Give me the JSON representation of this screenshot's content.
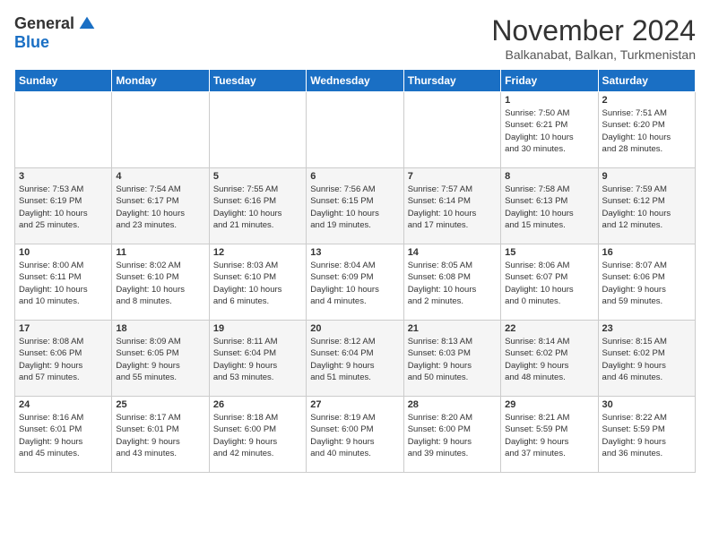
{
  "header": {
    "logo_general": "General",
    "logo_blue": "Blue",
    "month_title": "November 2024",
    "subtitle": "Balkanabat, Balkan, Turkmenistan"
  },
  "weekdays": [
    "Sunday",
    "Monday",
    "Tuesday",
    "Wednesday",
    "Thursday",
    "Friday",
    "Saturday"
  ],
  "weeks": [
    [
      {
        "day": "",
        "info": ""
      },
      {
        "day": "",
        "info": ""
      },
      {
        "day": "",
        "info": ""
      },
      {
        "day": "",
        "info": ""
      },
      {
        "day": "",
        "info": ""
      },
      {
        "day": "1",
        "info": "Sunrise: 7:50 AM\nSunset: 6:21 PM\nDaylight: 10 hours\nand 30 minutes."
      },
      {
        "day": "2",
        "info": "Sunrise: 7:51 AM\nSunset: 6:20 PM\nDaylight: 10 hours\nand 28 minutes."
      }
    ],
    [
      {
        "day": "3",
        "info": "Sunrise: 7:53 AM\nSunset: 6:19 PM\nDaylight: 10 hours\nand 25 minutes."
      },
      {
        "day": "4",
        "info": "Sunrise: 7:54 AM\nSunset: 6:17 PM\nDaylight: 10 hours\nand 23 minutes."
      },
      {
        "day": "5",
        "info": "Sunrise: 7:55 AM\nSunset: 6:16 PM\nDaylight: 10 hours\nand 21 minutes."
      },
      {
        "day": "6",
        "info": "Sunrise: 7:56 AM\nSunset: 6:15 PM\nDaylight: 10 hours\nand 19 minutes."
      },
      {
        "day": "7",
        "info": "Sunrise: 7:57 AM\nSunset: 6:14 PM\nDaylight: 10 hours\nand 17 minutes."
      },
      {
        "day": "8",
        "info": "Sunrise: 7:58 AM\nSunset: 6:13 PM\nDaylight: 10 hours\nand 15 minutes."
      },
      {
        "day": "9",
        "info": "Sunrise: 7:59 AM\nSunset: 6:12 PM\nDaylight: 10 hours\nand 12 minutes."
      }
    ],
    [
      {
        "day": "10",
        "info": "Sunrise: 8:00 AM\nSunset: 6:11 PM\nDaylight: 10 hours\nand 10 minutes."
      },
      {
        "day": "11",
        "info": "Sunrise: 8:02 AM\nSunset: 6:10 PM\nDaylight: 10 hours\nand 8 minutes."
      },
      {
        "day": "12",
        "info": "Sunrise: 8:03 AM\nSunset: 6:10 PM\nDaylight: 10 hours\nand 6 minutes."
      },
      {
        "day": "13",
        "info": "Sunrise: 8:04 AM\nSunset: 6:09 PM\nDaylight: 10 hours\nand 4 minutes."
      },
      {
        "day": "14",
        "info": "Sunrise: 8:05 AM\nSunset: 6:08 PM\nDaylight: 10 hours\nand 2 minutes."
      },
      {
        "day": "15",
        "info": "Sunrise: 8:06 AM\nSunset: 6:07 PM\nDaylight: 10 hours\nand 0 minutes."
      },
      {
        "day": "16",
        "info": "Sunrise: 8:07 AM\nSunset: 6:06 PM\nDaylight: 9 hours\nand 59 minutes."
      }
    ],
    [
      {
        "day": "17",
        "info": "Sunrise: 8:08 AM\nSunset: 6:06 PM\nDaylight: 9 hours\nand 57 minutes."
      },
      {
        "day": "18",
        "info": "Sunrise: 8:09 AM\nSunset: 6:05 PM\nDaylight: 9 hours\nand 55 minutes."
      },
      {
        "day": "19",
        "info": "Sunrise: 8:11 AM\nSunset: 6:04 PM\nDaylight: 9 hours\nand 53 minutes."
      },
      {
        "day": "20",
        "info": "Sunrise: 8:12 AM\nSunset: 6:04 PM\nDaylight: 9 hours\nand 51 minutes."
      },
      {
        "day": "21",
        "info": "Sunrise: 8:13 AM\nSunset: 6:03 PM\nDaylight: 9 hours\nand 50 minutes."
      },
      {
        "day": "22",
        "info": "Sunrise: 8:14 AM\nSunset: 6:02 PM\nDaylight: 9 hours\nand 48 minutes."
      },
      {
        "day": "23",
        "info": "Sunrise: 8:15 AM\nSunset: 6:02 PM\nDaylight: 9 hours\nand 46 minutes."
      }
    ],
    [
      {
        "day": "24",
        "info": "Sunrise: 8:16 AM\nSunset: 6:01 PM\nDaylight: 9 hours\nand 45 minutes."
      },
      {
        "day": "25",
        "info": "Sunrise: 8:17 AM\nSunset: 6:01 PM\nDaylight: 9 hours\nand 43 minutes."
      },
      {
        "day": "26",
        "info": "Sunrise: 8:18 AM\nSunset: 6:00 PM\nDaylight: 9 hours\nand 42 minutes."
      },
      {
        "day": "27",
        "info": "Sunrise: 8:19 AM\nSunset: 6:00 PM\nDaylight: 9 hours\nand 40 minutes."
      },
      {
        "day": "28",
        "info": "Sunrise: 8:20 AM\nSunset: 6:00 PM\nDaylight: 9 hours\nand 39 minutes."
      },
      {
        "day": "29",
        "info": "Sunrise: 8:21 AM\nSunset: 5:59 PM\nDaylight: 9 hours\nand 37 minutes."
      },
      {
        "day": "30",
        "info": "Sunrise: 8:22 AM\nSunset: 5:59 PM\nDaylight: 9 hours\nand 36 minutes."
      }
    ]
  ]
}
